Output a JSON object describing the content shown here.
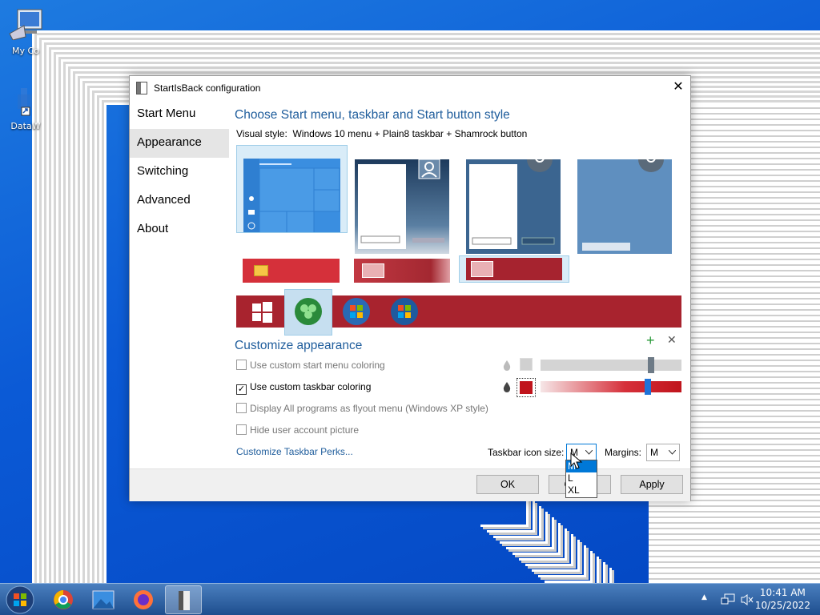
{
  "desktop": {
    "icons": [
      {
        "label": "My Co",
        "name": "computer"
      },
      {
        "label": "DataW",
        "name": "datawrapper"
      }
    ]
  },
  "window": {
    "title": "StartIsBack configuration",
    "close": "✕"
  },
  "nav": {
    "items": [
      {
        "label": "Start Menu",
        "selected": false
      },
      {
        "label": "Appearance",
        "selected": true
      },
      {
        "label": "Switching",
        "selected": false
      },
      {
        "label": "Advanced",
        "selected": false
      },
      {
        "label": "About",
        "selected": false
      }
    ]
  },
  "style_section": {
    "heading": "Choose Start menu, taskbar and Start button style",
    "visual_style_label": "Visual style:",
    "visual_style_value": "Windows 10 menu + Plain8 taskbar + Shamrock button",
    "menu_styles_selected": 0,
    "taskbar_styles_selected": 2,
    "start_buttons_selected": 1
  },
  "customize": {
    "heading": "Customize appearance",
    "add_icon": "+",
    "remove_icon": "✕",
    "options": [
      {
        "label": "Use custom start menu coloring",
        "checked": false,
        "enabled": false
      },
      {
        "label": "Use custom taskbar coloring",
        "checked": true,
        "enabled": true
      },
      {
        "label": "Display All programs as flyout menu (Windows XP style)",
        "checked": false,
        "enabled": false
      },
      {
        "label": "Hide user account picture",
        "checked": false,
        "enabled": false
      }
    ],
    "start_menu_color": "#d0d0d0",
    "taskbar_color": "#c0141c",
    "start_menu_slider_level": 0.76,
    "taskbar_slider_level": 0.76,
    "perks_link": "Customize Taskbar Perks...",
    "icon_size_label": "Taskbar icon size:",
    "icon_size_value": "M",
    "margins_label": "Margins:",
    "margins_value": "M",
    "icon_size_options": [
      "M",
      "L",
      "XL"
    ]
  },
  "footer": {
    "ok": "OK",
    "cancel": "Cancel",
    "apply": "Apply"
  },
  "taskbar": {
    "time": "10:41 AM",
    "date": "10/25/2022",
    "tray_arrow": "▲"
  },
  "colors": {
    "accent_heading": "#1f5d9c",
    "taskbar_red": "#a8232e",
    "selection_blue": "#0078d7"
  }
}
